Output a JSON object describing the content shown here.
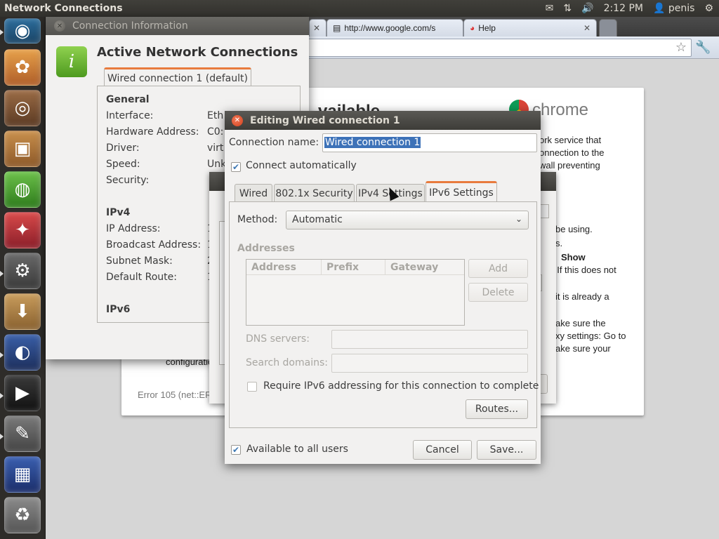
{
  "topbar": {
    "title": "Network Connections",
    "time": "2:12 PM",
    "user": "penis"
  },
  "launcher": {
    "items": [
      "chromium",
      "paint",
      "speaker",
      "package",
      "ubuntu-one",
      "wand",
      "settings",
      "download",
      "firefox",
      "terminal",
      "tools",
      "workspaces",
      "trash"
    ]
  },
  "browser": {
    "tabs": [
      {
        "label": ""
      },
      {
        "label": "http://www.google.com/s"
      },
      {
        "label": "Help"
      }
    ],
    "error": {
      "brand": "chrome",
      "heading_fragment": "vailable",
      "lines": [
        "ork service that",
        "onnection to the",
        "wall preventing",
        "be using.",
        "s.",
        "Show",
        "\" If this does not",
        "it is already a",
        "ake sure the",
        "xy settings: Go to",
        "ake sure your"
      ],
      "configuratio": "configuratio",
      "code": "Error 105 (net::ER"
    }
  },
  "conninfo": {
    "title": "Connection Information",
    "heading": "Active Network Connections",
    "tab": "Wired connection 1 (default)",
    "general": "General",
    "rows": [
      {
        "label": "Interface:",
        "value": "Eth"
      },
      {
        "label": "Hardware Address:",
        "value": "C0:"
      },
      {
        "label": "Driver:",
        "value": "virt"
      },
      {
        "label": "Speed:",
        "value": "Unk"
      },
      {
        "label": "Security:",
        "value": ""
      }
    ],
    "ipv4": "IPv4",
    "ipv4_rows": [
      {
        "label": "IP Address:",
        "value": "1"
      },
      {
        "label": "Broadcast Address:",
        "value": "1"
      },
      {
        "label": "Subnet Mask:",
        "value": "2"
      },
      {
        "label": "Default Route:",
        "value": "1"
      }
    ],
    "ipv6": "IPv6"
  },
  "editor": {
    "title": "Editing Wired connection 1",
    "name_label": "Connection name:",
    "name_value": "Wired connection 1",
    "connect_auto": "Connect automatically",
    "tabs": [
      "Wired",
      "802.1x Security",
      "IPv4 Settings",
      "IPv6 Settings"
    ],
    "method_label": "Method:",
    "method_value": "Automatic",
    "addresses": "Addresses",
    "columns": [
      "Address",
      "Prefix",
      "Gateway"
    ],
    "add": "Add",
    "delete": "Delete",
    "dns_label": "DNS servers:",
    "search_label": "Search domains:",
    "require_ipv6": "Require IPv6 addressing for this connection to complete",
    "routes": "Routes...",
    "all_users": "Available to all users",
    "cancel": "Cancel",
    "save": "Save..."
  }
}
